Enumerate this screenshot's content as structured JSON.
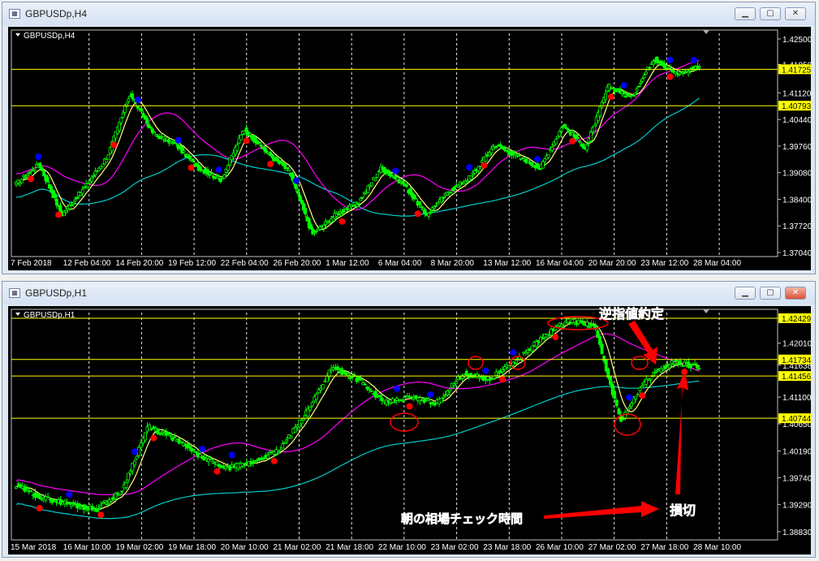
{
  "windows": [
    {
      "title": "GBPUSDp,H4",
      "label": "GBPUSDp,H4",
      "price_ticks": [
        "1.42500",
        "1.41850",
        "1.41120",
        "1.40440",
        "1.39760",
        "1.39080",
        "1.38400",
        "1.37720",
        "1.37040"
      ],
      "time_ticks": [
        "7 Feb 2018",
        "12 Feb 04:00",
        "14 Feb 20:00",
        "19 Feb 12:00",
        "22 Feb 04:00",
        "26 Feb 20:00",
        "1 Mar 12:00",
        "6 Mar 04:00",
        "8 Mar 20:00",
        "13 Mar 12:00",
        "16 Mar 04:00",
        "20 Mar 20:00",
        "23 Mar 12:00",
        "28 Mar 04:00"
      ],
      "levels": [
        {
          "price": 1.41725,
          "label": "1.41725"
        },
        {
          "price": 1.40793,
          "label": "1.40793"
        }
      ]
    },
    {
      "title": "GBPUSDp,H1",
      "label": "GBPUSDp,H1",
      "price_ticks": [
        "1.42429",
        "1.42010",
        "1.41638",
        "1.41100",
        "1.40650",
        "1.40190",
        "1.39740",
        "1.39290",
        "1.38830"
      ],
      "time_ticks": [
        "15 Mar 2018",
        "16 Mar 10:00",
        "19 Mar 02:00",
        "19 Mar 18:00",
        "20 Mar 10:00",
        "21 Mar 02:00",
        "21 Mar 18:00",
        "22 Mar 10:00",
        "23 Mar 02:00",
        "23 Mar 18:00",
        "26 Mar 10:00",
        "27 Mar 02:00",
        "27 Mar 18:00",
        "28 Mar 10:00"
      ],
      "levels": [
        {
          "price": 1.42429,
          "label": "1.42429"
        },
        {
          "price": 1.41734,
          "label": "1.41734"
        },
        {
          "price": 1.41456,
          "label": "1.41456"
        },
        {
          "price": 1.40744,
          "label": "1.40744"
        }
      ]
    }
  ],
  "annotations": {
    "stop_entry": "逆指値約定",
    "stop_loss": "損切",
    "morning_check": "朝の相場チェック時間"
  },
  "colors": {
    "candle": "#00ff00",
    "ma_fast": "#ffff80",
    "ma_mid": "#ff00ff",
    "ma_slow": "#00cccc",
    "level": "#ffff00",
    "grid": "#ffffff",
    "swing_high": "#0000ff",
    "swing_low": "#ff0000",
    "annotation": "#ff0000"
  }
}
